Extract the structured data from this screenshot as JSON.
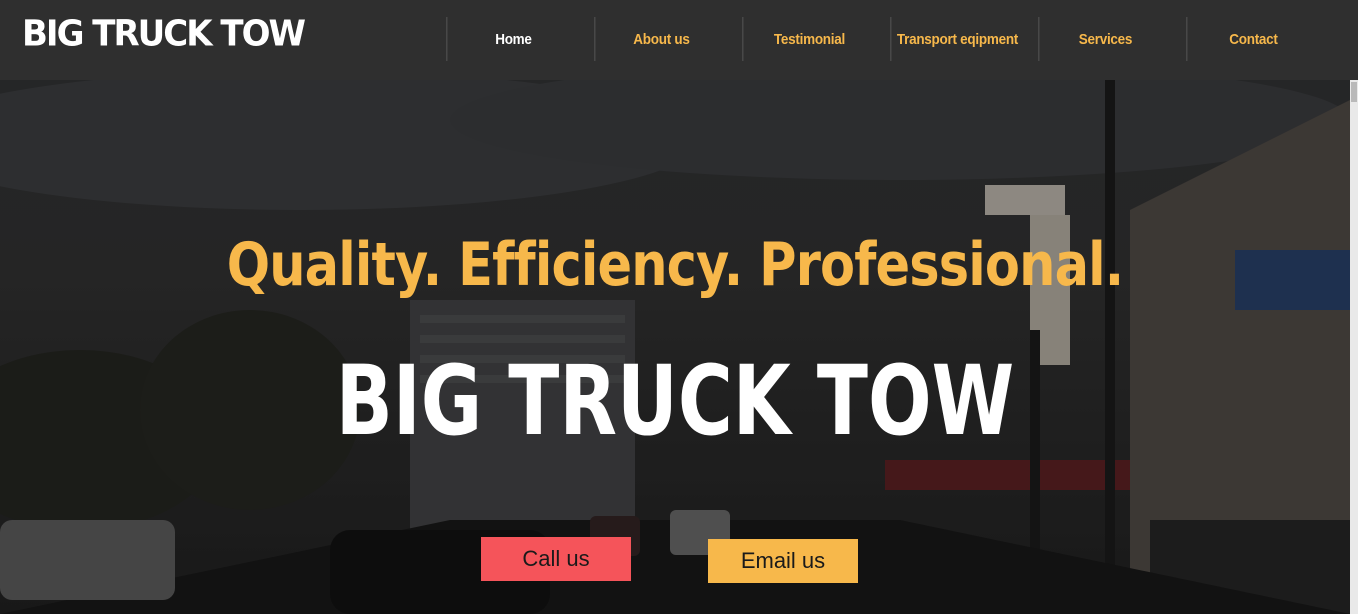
{
  "header": {
    "logo": "BIG TRUCK TOW",
    "nav": [
      {
        "label": "Home",
        "active": true
      },
      {
        "label": "About us",
        "active": false
      },
      {
        "label": "Testimonial",
        "active": false
      },
      {
        "label": "Transport eqipment",
        "active": false
      },
      {
        "label": "Services",
        "active": false
      },
      {
        "label": "Contact",
        "active": false
      }
    ]
  },
  "hero": {
    "tagline": "Quality. Efficiency. Professional.",
    "title": "BIG TRUCK TOW",
    "call_button": "Call us",
    "email_button": "Email us"
  },
  "colors": {
    "accent": "#f7b84b",
    "call_button": "#f5545a",
    "header_bg": "#2f2f2f"
  }
}
